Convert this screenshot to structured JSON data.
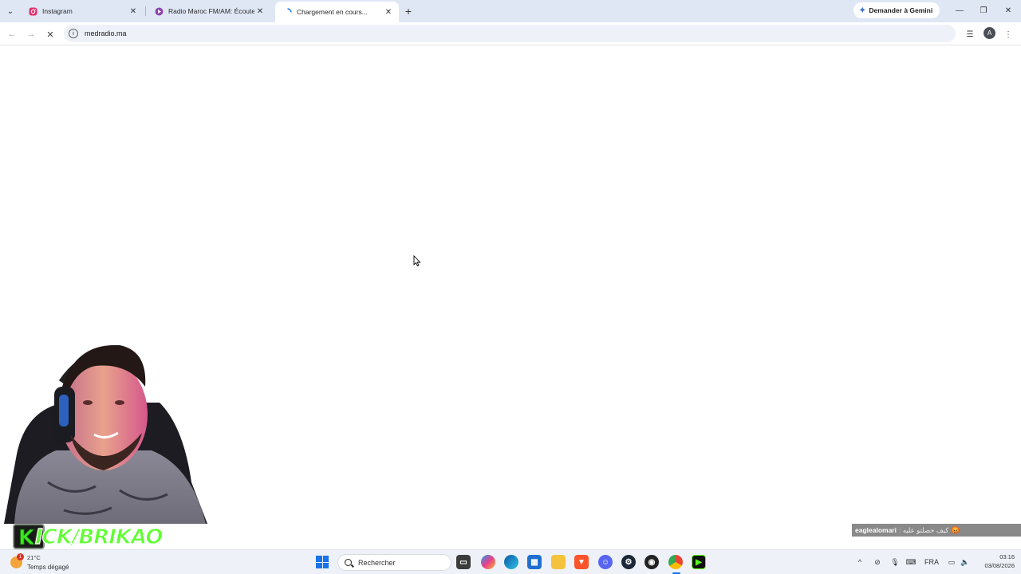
{
  "browser": {
    "tabs": [
      {
        "title": "Instagram",
        "favicon": "instagram-icon",
        "active": false
      },
      {
        "title": "Radio Maroc FM/AM: Écouter e",
        "favicon": "radio-icon",
        "active": false
      },
      {
        "title": "Chargement en cours...",
        "favicon": "loading-spinner-icon",
        "active": true
      }
    ],
    "gemini_label": "Demander à Gemini",
    "url": "medradio.ma",
    "profile_initial": "A"
  },
  "overlay": {
    "brand_letter": "K",
    "brand_text": "ICK/BRIKAO",
    "chat_user": "eaglealomari",
    "chat_message": ": ‎كيف حصلتو عليه",
    "chat_emoji": "😡"
  },
  "taskbar": {
    "weather_temp": "21°C",
    "weather_badge": "1",
    "weather_condition": "Temps dégagé",
    "search_placeholder": "Rechercher",
    "language": "FRA",
    "time": "03:16",
    "date": "03/08/2026"
  },
  "colors": {
    "tabstrip_bg": "#dfe7f5",
    "omnibox_bg": "#eef1f7",
    "taskbar_bg": "#eef2f8",
    "kick_green": "#5dff2f"
  }
}
